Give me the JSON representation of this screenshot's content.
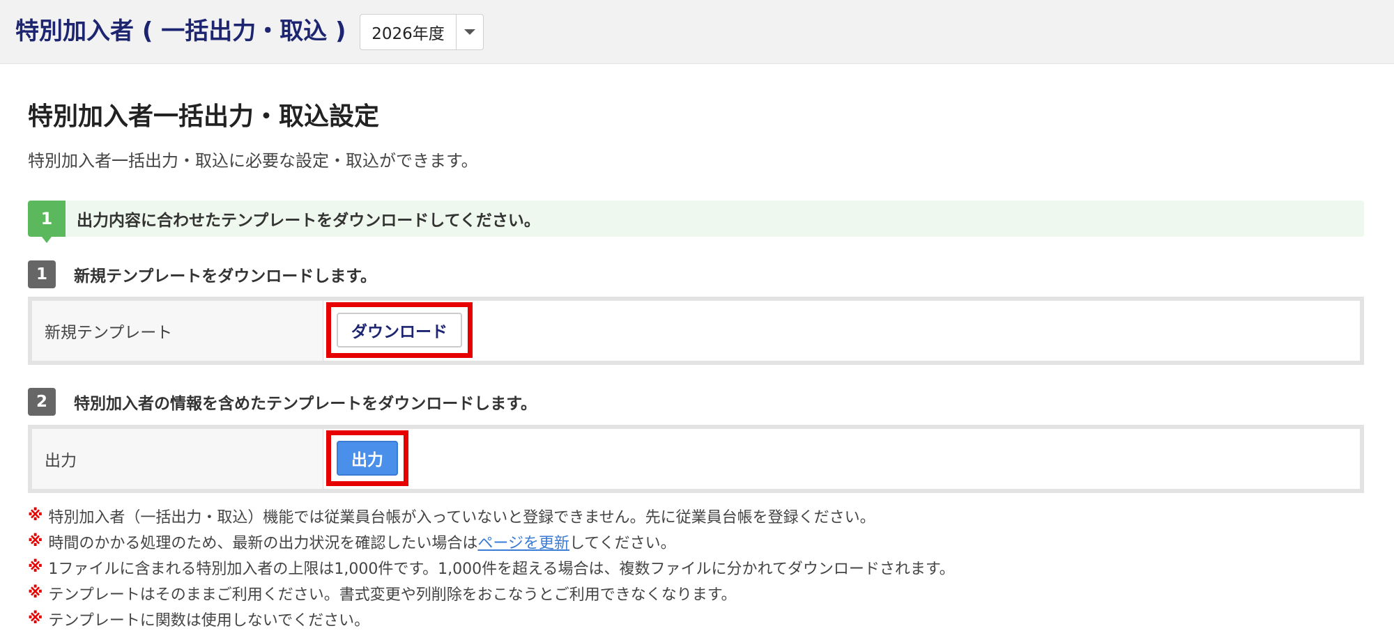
{
  "header": {
    "title": "特別加入者 ( 一括出力・取込 )",
    "year_select": {
      "value": "2026年度"
    }
  },
  "page": {
    "title": "特別加入者一括出力・取込設定",
    "description": "特別加入者一括出力・取込に必要な設定・取込ができます。"
  },
  "step1": {
    "number": "1",
    "text": "出力内容に合わせたテンプレートをダウンロードしてください。",
    "accent": "#5cb85c"
  },
  "sub1": {
    "number": "1",
    "text": "新規テンプレートをダウンロードします。",
    "row_label": "新規テンプレート",
    "button_label": "ダウンロード"
  },
  "sub2": {
    "number": "2",
    "text": "特別加入者の情報を含めたテンプレートをダウンロードします。",
    "row_label": "出力",
    "button_label": "出力"
  },
  "notes": {
    "mark": "※",
    "items": [
      "特別加入者（一括出力・取込）機能では従業員台帳が入っていないと登録できません。先に従業員台帳を登録ください。",
      "1ファイルに含まれる特別加入者の上限は1,000件です。1,000件を超える場合は、複数ファイルに分かれてダウンロードされます。",
      "テンプレートはそのままご利用ください。書式変更や列削除をおこなうとご利用できなくなります。",
      "テンプレートに関数は使用しないでください。"
    ],
    "refresh_note": {
      "before": "時間のかかる処理のため、最新の出力状況を確認したい場合は",
      "link": "ページを更新",
      "after": "してください。"
    }
  },
  "colors": {
    "title": "#1d2570",
    "highlight": "#e60000",
    "primary_button": "#4a8fea",
    "link": "#3a7bd5"
  }
}
